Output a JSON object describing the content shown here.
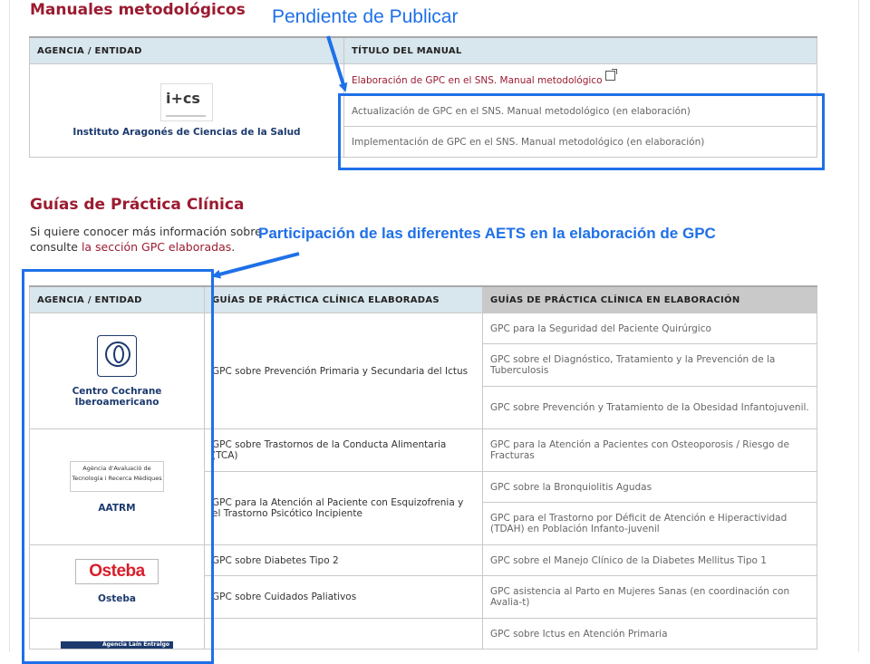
{
  "section1": {
    "title": "Manuales metodológicos",
    "col_agency": "AGENCIA / ENTIDAD",
    "col_title": "TÍTULO DEL MANUAL",
    "agency_name": "Instituto Aragonés de Ciencias de la Salud",
    "logo_text": "i+cs",
    "manuals": [
      "Elaboración de GPC en el SNS. Manual metodológico",
      "Actualización de GPC en el SNS. Manual metodológico (en elaboración)",
      "Implementación de GPC en el SNS. Manual metodológico (en elaboración)"
    ]
  },
  "callout1": {
    "label": "Pendiente de Publicar"
  },
  "section2": {
    "title": "Guías de Práctica Clínica",
    "intro_text": "Si quiere conocer más información sobre consulte",
    "intro_link": "la sección GPC elaboradas",
    "intro_end": ".",
    "col_agency": "AGENCIA / ENTIDAD",
    "col_done": "GUÍAS DE PRÁCTICA CLÍNICA ELABORADAS",
    "col_progress": "GUÍAS DE PRÁCTICA CLÍNICA EN ELABORACIÓN",
    "agencies": [
      {
        "name_line1": "Centro Cochrane",
        "name_line2": "Iberoamericano",
        "done": [
          "GPC sobre Prevención Primaria y Secundaria del Ictus"
        ],
        "progress": [
          "GPC para la Seguridad del Paciente Quirúrgico",
          "GPC sobre el Diagnóstico, Tratamiento y la Prevención de la Tuberculosis",
          "GPC sobre Prevención y Tratamiento de la Obesidad Infantojuvenil."
        ]
      },
      {
        "name_line1": "AATRM",
        "logo_line1": "Agència d'Avaluació de",
        "logo_line2": "Tecnologia i Recerca Mèdiques",
        "done": [
          "GPC sobre Trastornos de la Conducta Alimentaria (TCA)",
          "GPC para la Atención al Paciente con Esquizofrenia y el Trastorno Psicótico Incipiente"
        ],
        "progress": [
          "GPC para la Atención a Pacientes con Osteoporosis / Riesgo de Fracturas",
          "GPC sobre la Bronquiolitis Agudas",
          "GPC para el Trastorno por Déficit de Atención e Hiperactividad (TDAH) en Población Infanto-juvenil"
        ]
      },
      {
        "name_line1": "Osteba",
        "logo_text": "Osteba",
        "done": [
          "GPC sobre Diabetes Tipo 2",
          "GPC sobre Cuidados Paliativos"
        ],
        "progress": [
          "GPC sobre el Manejo Clínico de la Diabetes Mellitus Tipo 1",
          "GPC asistencia al Parto en Mujeres Sanas (en coordinación con Avalia-t)"
        ]
      },
      {
        "logo_text": "Agencia Laín Entralgo",
        "progress": [
          "GPC sobre Ictus en Atención Primaria"
        ]
      }
    ]
  },
  "callout2": {
    "label": "Participación de las diferentes AETS en la elaboración de GPC"
  },
  "colors": {
    "maroon": "#9b1b30",
    "header_bg": "#d8e6ed",
    "annotation_blue": "#1e70e8"
  }
}
